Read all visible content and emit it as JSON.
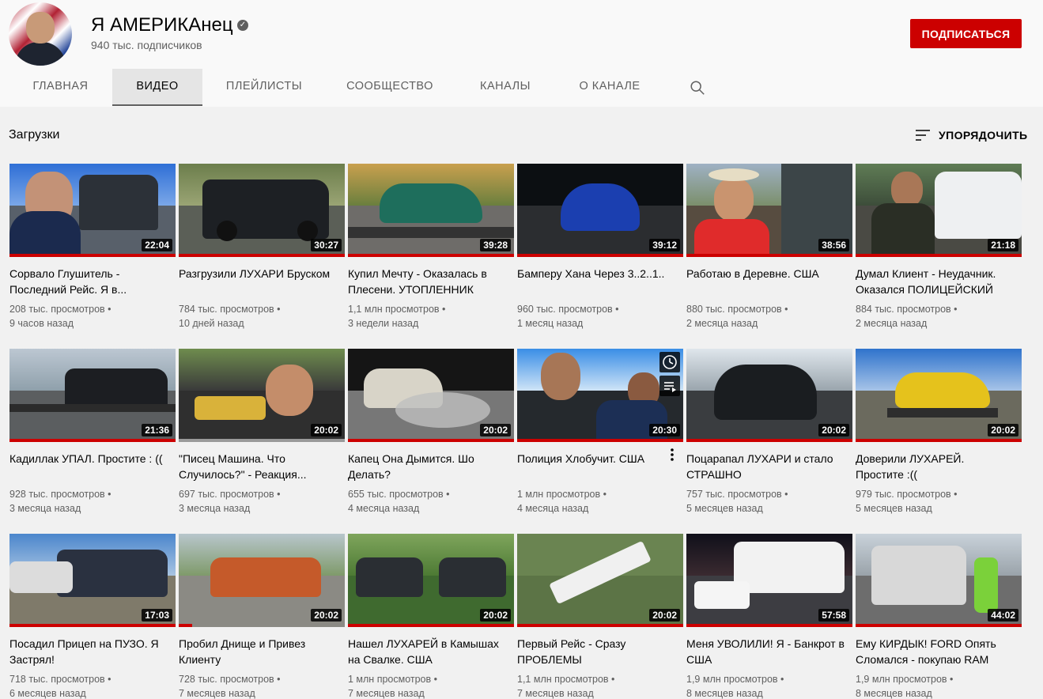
{
  "channel": {
    "name": "Я АМЕРИКАнец",
    "subscribers": "940 тыс. подписчиков",
    "subscribe_label": "ПОДПИСАТЬСЯ"
  },
  "tabs": [
    {
      "label": "ГЛАВНАЯ"
    },
    {
      "label": "ВИДЕО"
    },
    {
      "label": "ПЛЕЙЛИСТЫ"
    },
    {
      "label": "СООБЩЕСТВО"
    },
    {
      "label": "КАНАЛЫ"
    },
    {
      "label": "О КАНАЛЕ"
    }
  ],
  "section": {
    "title": "Загрузки",
    "sort_label": "УПОРЯДОЧИТЬ"
  },
  "videos": [
    {
      "title": "Сорвало Глушитель - Последний Рейс. Я в...",
      "views": "208 тыс. просмотров",
      "age": "9 часов назад",
      "duration": "22:04"
    },
    {
      "title": "Разгрузили ЛУХАРИ Бруском",
      "views": "784 тыс. просмотров",
      "age": "10 дней назад",
      "duration": "30:27"
    },
    {
      "title": "Купил Мечту - Оказалась в Плесени. УТОПЛЕННИК",
      "views": "1,1 млн просмотров",
      "age": "3 недели назад",
      "duration": "39:28"
    },
    {
      "title": "Бамперу Хана Через 3..2..1..",
      "views": "960 тыс. просмотров",
      "age": "1 месяц назад",
      "duration": "39:12"
    },
    {
      "title": "Работаю в Деревне. США",
      "views": "880 тыс. просмотров",
      "age": "2 месяца назад",
      "duration": "38:56"
    },
    {
      "title": "Думал Клиент - Неудачник. Оказался ПОЛИЦЕЙСКИЙ",
      "views": "884 тыс. просмотров",
      "age": "2 месяца назад",
      "duration": "21:18"
    },
    {
      "title": "Кадиллак УПАЛ. Простите : ((",
      "views": "928 тыс. просмотров",
      "age": "3 месяца назад",
      "duration": "21:36"
    },
    {
      "title": "\"Писец Машина. Что Случилось?\" - Реакция...",
      "views": "697 тыс. просмотров",
      "age": "3 месяца назад",
      "duration": "20:02"
    },
    {
      "title": "Капец Она Дымится. Шо Делать?",
      "views": "655 тыс. просмотров",
      "age": "4 месяца назад",
      "duration": "20:02"
    },
    {
      "title": "Полиция Хлобучит. США",
      "views": "1 млн просмотров",
      "age": "4 месяца назад",
      "duration": "20:30"
    },
    {
      "title": "Поцарапал ЛУХАРИ и стало СТРАШНО",
      "views": "757 тыс. просмотров",
      "age": "5 месяцев назад",
      "duration": "20:02"
    },
    {
      "title": "Доверили ЛУХАРЕЙ. Простите :((",
      "views": "979 тыс. просмотров",
      "age": "5 месяцев назад",
      "duration": "20:02"
    },
    {
      "title": "Посадил Прицеп на ПУЗО. Я Застрял!",
      "views": "718 тыс. просмотров",
      "age": "6 месяцев назад",
      "duration": "17:03"
    },
    {
      "title": "Пробил Днище и Привез Клиенту",
      "views": "728 тыс. просмотров",
      "age": "7 месяцев назад",
      "duration": "20:02"
    },
    {
      "title": "Нашел ЛУХАРЕЙ в Камышах на Свалке. США",
      "views": "1 млн просмотров",
      "age": "7 месяцев назад",
      "duration": "20:02"
    },
    {
      "title": "Первый Рейс - Сразу ПРОБЛЕМЫ",
      "views": "1,1 млн просмотров",
      "age": "7 месяцев назад",
      "duration": "20:02"
    },
    {
      "title": "Меня УВОЛИЛИ! Я - Банкрот в США",
      "views": "1,9 млн просмотров",
      "age": "8 месяцев назад",
      "duration": "57:58"
    },
    {
      "title": "Ему КИРДЫК! FORD Опять Сломался - покупаю RAM",
      "views": "1,9 млн просмотров",
      "age": "8 месяцев назад",
      "duration": "44:02"
    }
  ]
}
